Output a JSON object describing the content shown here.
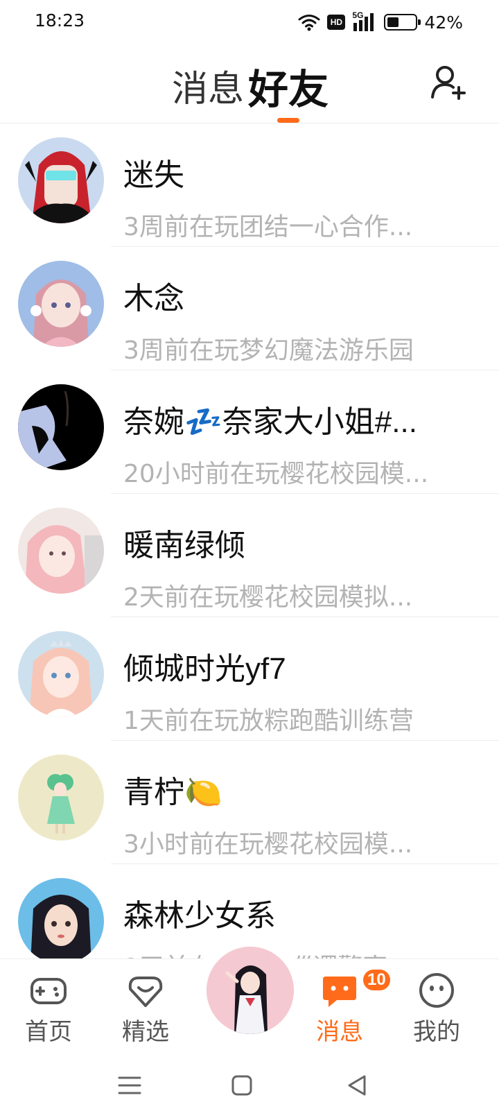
{
  "status_bar": {
    "time": "18:23",
    "network": "5G",
    "hd": "HD",
    "battery_percent": 42,
    "battery_text": "42%"
  },
  "header": {
    "tab_messages": "消息",
    "tab_friends": "好友",
    "active_tab": "好友",
    "add_friend_icon": "add-person-icon"
  },
  "friends": [
    {
      "name": "迷失",
      "status": "3周前在玩团结一心合作..."
    },
    {
      "name": "木念",
      "status": "3周前在玩梦幻魔法游乐园"
    },
    {
      "name": "奈婉💤奈家大小姐#...",
      "status": "20小时前在玩樱花校园模..."
    },
    {
      "name": "暖南绿倾",
      "status": "2天前在玩樱花校园模拟..."
    },
    {
      "name": "倾城时光yf7",
      "status": "1天前在玩放粽跑酷训练营"
    },
    {
      "name": "青柠🍋",
      "status": "3小时前在玩樱花校园模..."
    },
    {
      "name": "森林少女系",
      "status": "1天前在玩...探巡逻警察"
    }
  ],
  "bottom_nav": {
    "home": "首页",
    "featured": "精选",
    "messages": "消息",
    "mine": "我的",
    "messages_badge": "10",
    "active": "消息"
  },
  "colors": {
    "accent": "#ff6b1a",
    "secondary_text": "#b3b3b3"
  }
}
